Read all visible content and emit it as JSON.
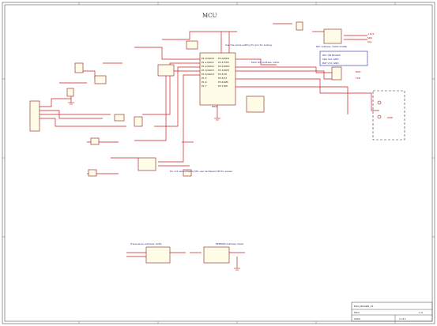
{
  "sheet": {
    "title": "MCU"
  },
  "mcu": {
    "part_label": "MCU",
    "pins_left": [
      "P1.0/ADC0",
      "P1.1/ADC1",
      "P1.2/ADC2",
      "P1.3/ADC3",
      "P1.4/ADC4",
      "P1.5",
      "P1.6",
      "P1.7"
    ],
    "pins_right": [
      "P3.0/RXD",
      "P3.1/TXD",
      "P3.2/INT0",
      "P3.3/INT1",
      "P3.4/T0",
      "P3.5/T1",
      "P3.6/WR",
      "P3.7/RD"
    ]
  },
  "notes": {
    "i2c_left": "MCU I2C Address: 0x5A",
    "i2c_right": "RTC Address: 0xD0 (0x68)",
    "rtc_box_lines": [
      "RTC ON BOARD",
      "SDA SCL GND",
      "BAT VCC GND"
    ],
    "note_mid": "Use the same setting for pin for analog",
    "note_bottom": "Do not use software SPI, use hardware SPI for sensor",
    "transceiver": "Transceiver Address: 0x6A",
    "eeprom": "EEPROM Address: 0xA0"
  },
  "nets": {
    "vcc": "+3V3",
    "gnd": "GND",
    "sda": "SDA",
    "scl": "SCL",
    "rxd": "RXD",
    "txd": "TXD"
  },
  "titleblock": {
    "company": "MCU_BOARD_V1",
    "sheet_title": "MCU",
    "rev": "1.0",
    "date": "2024",
    "sheet_no": "1 of 1"
  }
}
